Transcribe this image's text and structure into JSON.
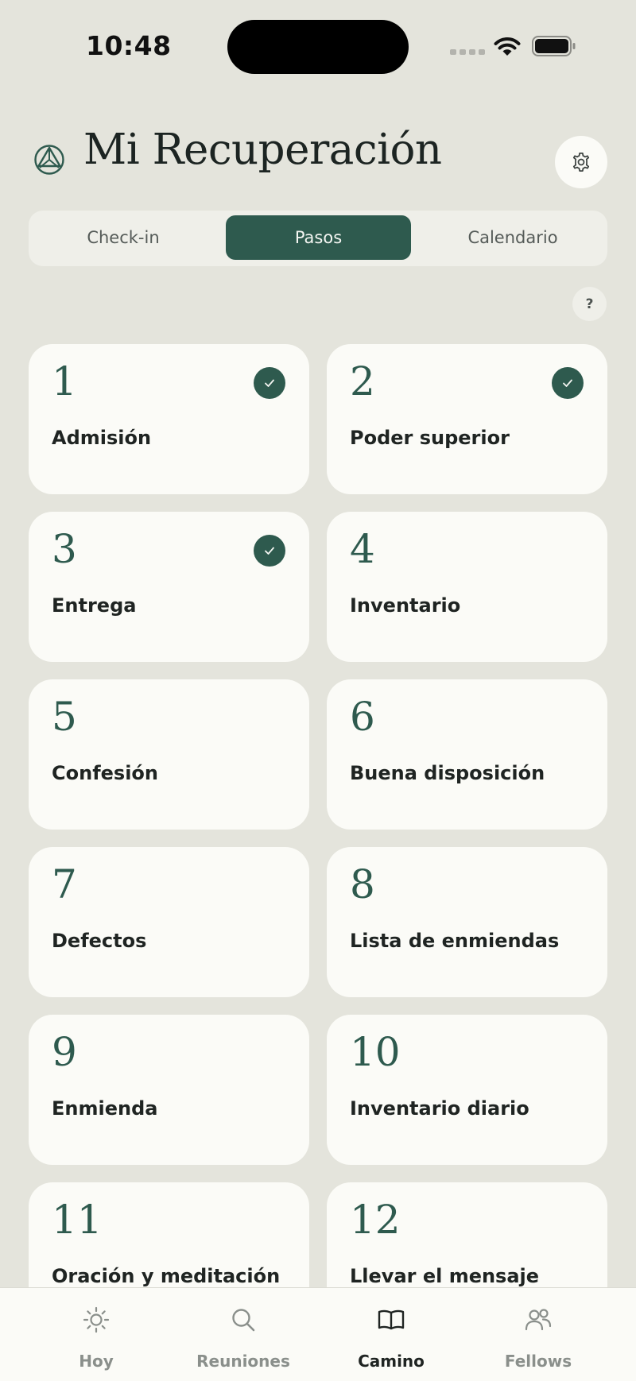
{
  "status_bar": {
    "time": "10:48"
  },
  "header": {
    "title": "Mi Recuperación"
  },
  "tabs": [
    {
      "label": "Check-in",
      "active": false
    },
    {
      "label": "Pasos",
      "active": true
    },
    {
      "label": "Calendario",
      "active": false
    }
  ],
  "help": {
    "label": "?"
  },
  "steps": [
    {
      "number": "1",
      "title": "Admisión",
      "completed": true
    },
    {
      "number": "2",
      "title": "Poder superior",
      "completed": true
    },
    {
      "number": "3",
      "title": "Entrega",
      "completed": true
    },
    {
      "number": "4",
      "title": "Inventario",
      "completed": false
    },
    {
      "number": "5",
      "title": "Confesión",
      "completed": false
    },
    {
      "number": "6",
      "title": "Buena disposición",
      "completed": false
    },
    {
      "number": "7",
      "title": "Defectos",
      "completed": false
    },
    {
      "number": "8",
      "title": "Lista de enmiendas",
      "completed": false
    },
    {
      "number": "9",
      "title": "Enmienda",
      "completed": false
    },
    {
      "number": "10",
      "title": "Inventario diario",
      "completed": false
    },
    {
      "number": "11",
      "title": "Oración y meditación",
      "completed": false
    },
    {
      "number": "12",
      "title": "Llevar el mensaje",
      "completed": false
    }
  ],
  "nav": [
    {
      "label": "Hoy",
      "icon": "sun-icon",
      "active": false
    },
    {
      "label": "Reuniones",
      "icon": "search-icon",
      "active": false
    },
    {
      "label": "Camino",
      "icon": "book-icon",
      "active": true
    },
    {
      "label": "Fellows",
      "icon": "people-icon",
      "active": false
    }
  ],
  "colors": {
    "accent": "#2e5a4e",
    "background": "#e4e4dc",
    "card": "#fbfbf7"
  }
}
